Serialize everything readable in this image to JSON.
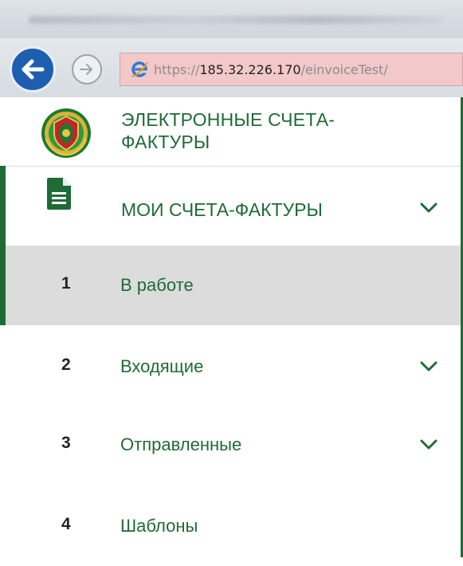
{
  "browser": {
    "url_protocol": "https://",
    "url_host": "185.32.226.170",
    "url_path": "/einvoiceTest/"
  },
  "header": {
    "title_line1": "ЭЛЕКТРОННЫЕ СЧЕТА-",
    "title_line2": "ФАКТУРЫ"
  },
  "menu": {
    "section_label": "МОИ СЧЕТА-ФАКТУРЫ",
    "items": [
      {
        "number": "1",
        "label": "В работе",
        "active": true,
        "has_submenu": false
      },
      {
        "number": "2",
        "label": "Входящие",
        "active": false,
        "has_submenu": true
      },
      {
        "number": "3",
        "label": "Отправленные",
        "active": false,
        "has_submenu": true
      },
      {
        "number": "4",
        "label": "Шаблоны",
        "active": false,
        "has_submenu": false
      }
    ]
  },
  "colors": {
    "accent_green": "#1f6b35",
    "active_bg": "#dcdcdc",
    "back_button_blue": "#1e5eb0",
    "address_bar_bg": "#f2c8c8"
  },
  "icons": [
    "back-arrow-icon",
    "forward-arrow-icon",
    "ie-icon",
    "emblem-logo",
    "document-icon",
    "chevron-down-icon"
  ]
}
